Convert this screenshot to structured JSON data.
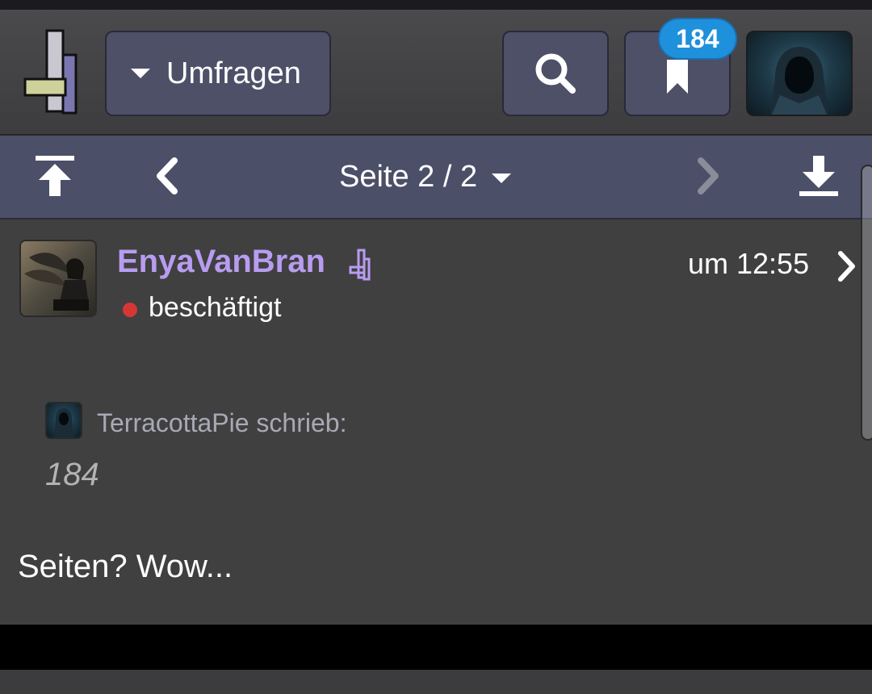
{
  "header": {
    "logo_icon": "forum-logo-icon",
    "dropdown_label": "Umfragen",
    "search_icon": "search-icon",
    "bookmark_icon": "bookmark-icon",
    "bookmark_badge": "184",
    "avatar_icon": "hooded-figure-avatar"
  },
  "pager": {
    "first_icon": "arrow-up-to-top-icon",
    "prev_icon": "chevron-left-icon",
    "page_label": "Seite 2 / 2",
    "next_icon": "chevron-right-icon",
    "last_icon": "arrow-down-to-bottom-icon"
  },
  "post": {
    "username": "EnyaVanBran",
    "status": "beschäftigt",
    "status_color": "#d63636",
    "time": "um 12:55",
    "quote": {
      "author": "TerracottaPie schrieb:",
      "text": "184"
    },
    "text": "Seiten? Wow..."
  },
  "colors": {
    "accent_button": "#4e5068",
    "pager_bar": "#4c4f68",
    "username": "#b89cf0",
    "badge": "#1f90dc"
  }
}
